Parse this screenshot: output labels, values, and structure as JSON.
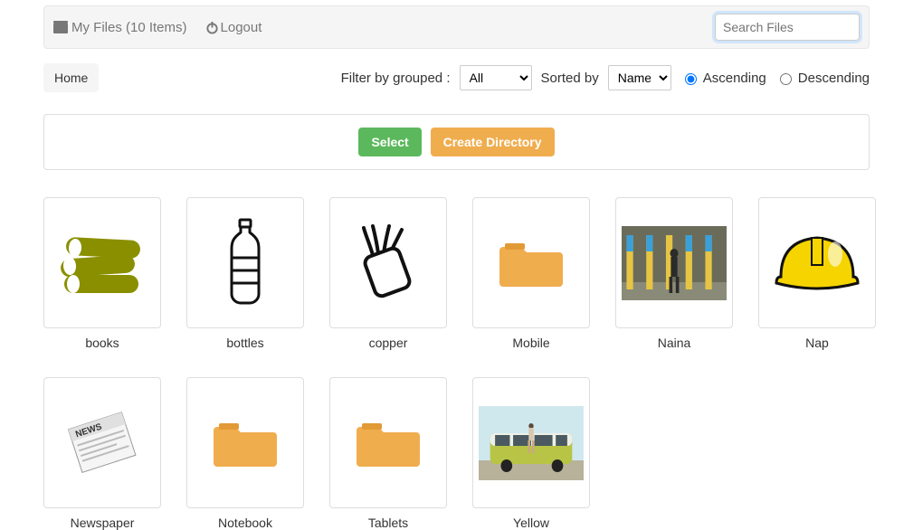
{
  "topbar": {
    "brand_label": "My Files (10 Items)",
    "logout_label": "Logout",
    "search_placeholder": "Search Files"
  },
  "breadcrumb": {
    "home": "Home"
  },
  "filter": {
    "grouped_label": "Filter by grouped :",
    "grouped_value": "All",
    "sorted_label": "Sorted by",
    "sorted_value": "Name",
    "asc_label": "Ascending",
    "desc_label": "Descending",
    "ascending_checked": true
  },
  "toolbar": {
    "select_label": "Select",
    "create_dir_label": "Create Directory"
  },
  "files": [
    {
      "name": "books",
      "kind": "books"
    },
    {
      "name": "bottles",
      "kind": "bottle"
    },
    {
      "name": "copper",
      "kind": "copper"
    },
    {
      "name": "Mobile",
      "kind": "folder"
    },
    {
      "name": "Naina",
      "kind": "photo-building"
    },
    {
      "name": "Nap",
      "kind": "hardhat"
    },
    {
      "name": "Newspaper",
      "kind": "newspaper"
    },
    {
      "name": "Notebook",
      "kind": "folder"
    },
    {
      "name": "Tablets",
      "kind": "folder"
    },
    {
      "name": "Yellow",
      "kind": "photo-van"
    }
  ]
}
